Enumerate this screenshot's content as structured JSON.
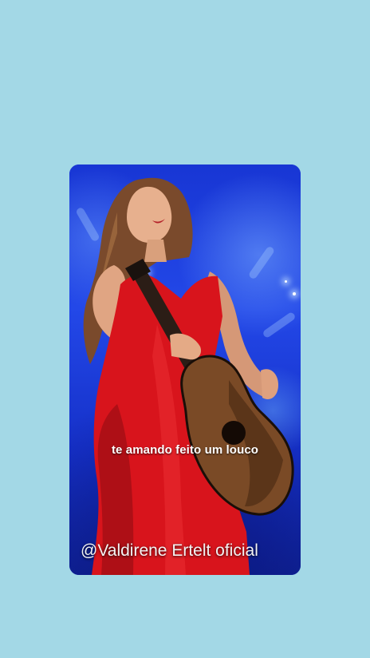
{
  "story": {
    "caption": "te amando feito um louco",
    "watermark": "@Valdirene Ertelt oficial"
  },
  "media": {
    "subject": "singer-in-red-dress-with-guitar-icon"
  },
  "colors": {
    "page_background": "#a3d8e6",
    "stage_blue": "#1d3fd6",
    "dress_red": "#d8141c",
    "caption_text": "#ffffff"
  }
}
